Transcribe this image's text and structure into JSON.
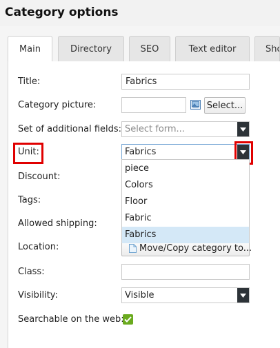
{
  "header": {
    "title": "Category options"
  },
  "tabs": [
    {
      "label": "Main"
    },
    {
      "label": "Directory"
    },
    {
      "label": "SEO"
    },
    {
      "label": "Text editor"
    },
    {
      "label": "Sho"
    }
  ],
  "form": {
    "title": {
      "label": "Title:",
      "value": "Fabrics"
    },
    "category_picture": {
      "label": "Category picture:",
      "button": "Select..."
    },
    "additional_fields": {
      "label": "Set of additional fields:",
      "placeholder": "Select form..."
    },
    "unit": {
      "label": "Unit:",
      "value": "Fabrics",
      "options": [
        "piece",
        "Colors",
        "Floor",
        "Fabric",
        "Fabrics"
      ],
      "selected_option": "Fabrics"
    },
    "discount": {
      "label": "Discount:"
    },
    "tags": {
      "label": "Tags:"
    },
    "allowed_shipping": {
      "label": "Allowed shipping:"
    },
    "location": {
      "label": "Location:",
      "button": "Move/Copy category to..."
    },
    "class": {
      "label": "Class:",
      "value": ""
    },
    "visibility": {
      "label": "Visibility:",
      "value": "Visible"
    },
    "searchable": {
      "label": "Searchable on the web:",
      "checked": true
    }
  },
  "colors": {
    "highlight": "#e00000",
    "checkbox": "#6aaa1e",
    "selected_option": "#d4e8f7",
    "select_arrow_bg": "#2d3338"
  }
}
